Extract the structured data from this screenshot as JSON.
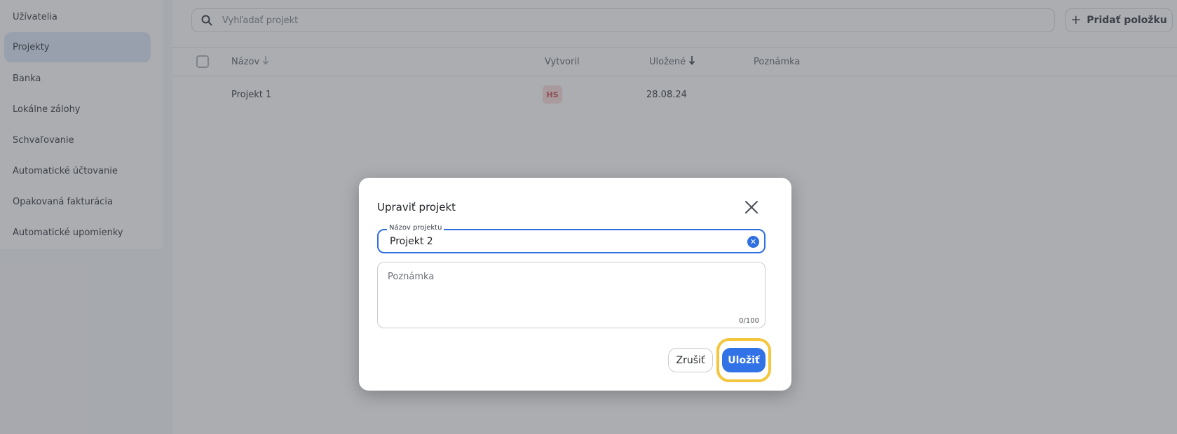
{
  "sidebar": {
    "items": [
      {
        "label": "Užívatelia"
      },
      {
        "label": "Projekty",
        "active": true
      },
      {
        "label": "Banka"
      },
      {
        "label": "Lokálne zálohy"
      },
      {
        "label": "Schvaľovanie"
      },
      {
        "label": "Automatické účtovanie"
      },
      {
        "label": "Opakovaná fakturácia"
      },
      {
        "label": "Automatické upomienky"
      }
    ]
  },
  "search": {
    "placeholder": "Vyhľadať projekt",
    "icon": "search-icon"
  },
  "toolbar": {
    "add_label": "Pridať položku",
    "add_icon": "plus"
  },
  "table": {
    "columns": {
      "name": "Názov",
      "created_by": "Vytvoril",
      "saved": "Uložené",
      "note": "Poznámka"
    },
    "rows": [
      {
        "name": "Projekt 1",
        "created_by": "HS",
        "saved": "28.08.24",
        "note": ""
      }
    ]
  },
  "dialog": {
    "title": "Upraviť projekt",
    "name_label": "Názov projektu",
    "name_value": "Projekt 2",
    "note_placeholder": "Poznámka",
    "note_counter": "0/100",
    "cancel_label": "Zrušiť",
    "save_label": "Uložiť"
  },
  "colors": {
    "accent": "#3173e6",
    "highlight": "#f4c63d",
    "avatar_bg": "#fbdada",
    "avatar_fg": "#c54545"
  }
}
